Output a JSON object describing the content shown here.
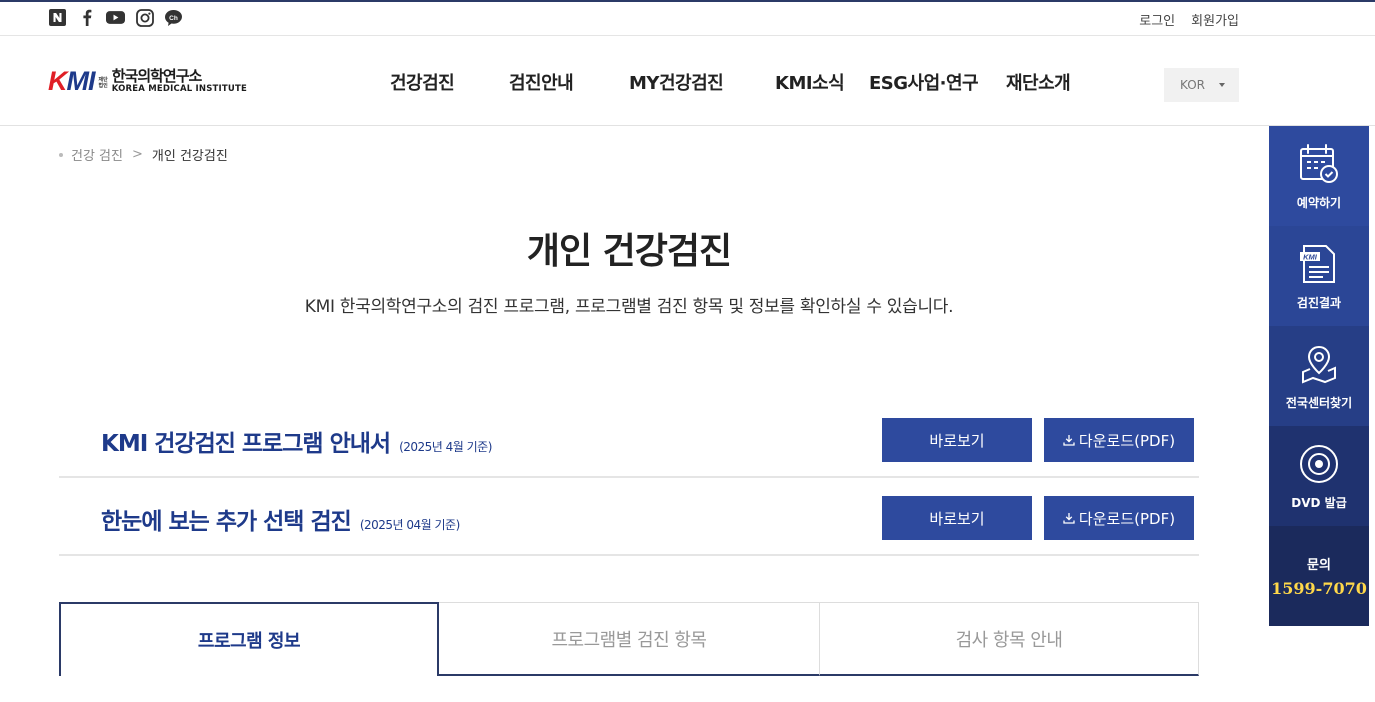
{
  "social": [
    {
      "name": "naver-blog-icon",
      "glyph": "N"
    },
    {
      "name": "facebook-icon",
      "glyph": "f"
    },
    {
      "name": "youtube-icon",
      "glyph": "yt"
    },
    {
      "name": "instagram-icon",
      "glyph": "ig"
    },
    {
      "name": "kakao-channel-icon",
      "glyph": "Ch"
    }
  ],
  "top_links": {
    "login": "로그인",
    "signup": "회원가입"
  },
  "logo": {
    "mark_k": "K",
    "mark_m": "M",
    "mark_i": "I",
    "small_1": "재단",
    "small_2": "법인",
    "ko": "한국의학연구소",
    "en": "KOREA MEDICAL INSTITUTE"
  },
  "nav": [
    "건강검진",
    "검진안내",
    "MY건강검진",
    "KMI소식",
    "ESG사업·연구",
    "재단소개"
  ],
  "lang": "KOR",
  "breadcrumb": {
    "parent": "건강 검진",
    "current": "개인 건강검진"
  },
  "page": {
    "title": "개인 건강검진",
    "subtitle": "KMI 한국의학연구소의 검진 프로그램, 프로그램별 검진 항목 및 정보를 확인하실 수 있습니다."
  },
  "guides": [
    {
      "title": "KMI 건강검진 프로그램 안내서",
      "date": "(2025년 4월 기준)",
      "view": "바로보기",
      "download": "다운로드(PDF)"
    },
    {
      "title": "한눈에 보는 추가 선택 검진",
      "date": "(2025년 04월 기준)",
      "view": "바로보기",
      "download": "다운로드(PDF)"
    }
  ],
  "tabs": [
    "프로그램 정보",
    "프로그램별 검진 항목",
    "검사 항목 안내"
  ],
  "quick": {
    "reserve": "예약하기",
    "result": "검진결과",
    "result_card": "KMI",
    "centers": "전국센터찾기",
    "dvd": "DVD 발급",
    "inquiry": "문의",
    "phone": "1599-7070"
  },
  "colors": {
    "primary": "#2e4a9e",
    "navy": "#1e3a8a",
    "accent_red": "#e01f26",
    "phone": "#ffd84a"
  }
}
